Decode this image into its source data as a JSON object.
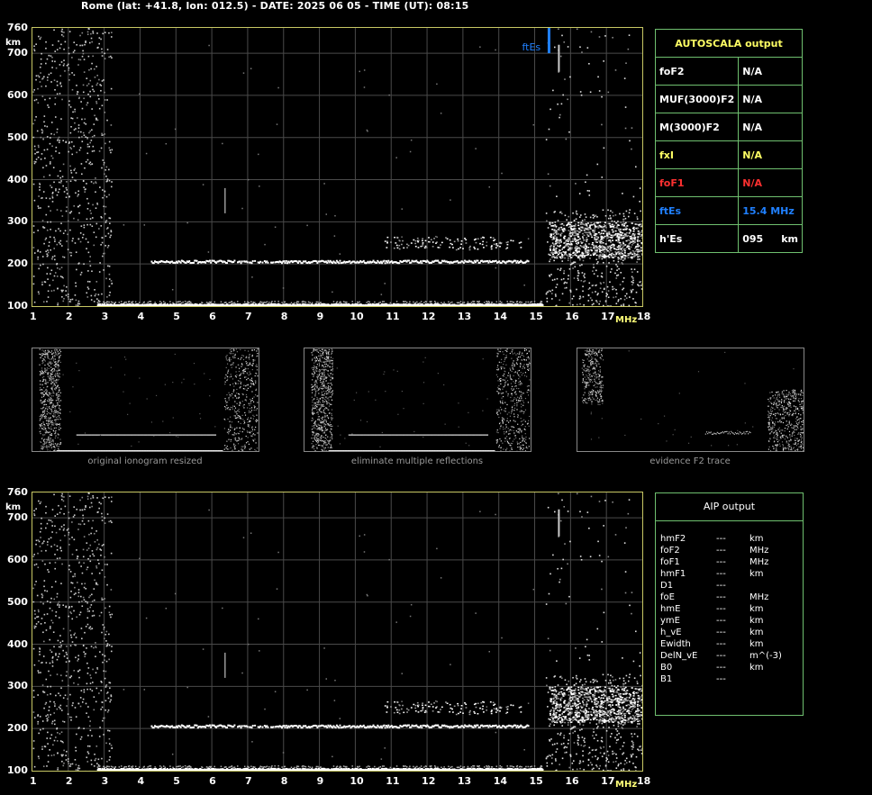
{
  "header": {
    "title": "Rome (lat: +41.8, lon: 012.5) - DATE: 2025 06 05 - TIME (UT): 08:15"
  },
  "axes": {
    "y_ticks": [
      "760",
      "700",
      "600",
      "500",
      "400",
      "300",
      "200",
      "100"
    ],
    "y_unit": "km",
    "x_ticks": [
      "1",
      "2",
      "3",
      "4",
      "5",
      "6",
      "7",
      "8",
      "9",
      "10",
      "11",
      "12",
      "13",
      "14",
      "15",
      "16",
      "17",
      "18"
    ],
    "x_unit": "MHz"
  },
  "ftes_marker": {
    "label": "ftEs",
    "freq_mhz": 15.4,
    "color": "#2080ff"
  },
  "autoscala": {
    "title": "AUTOSCALA output",
    "rows": [
      {
        "name": "foF2",
        "value": "N/A",
        "color": "#ffffff"
      },
      {
        "name": "MUF(3000)F2",
        "value": "N/A",
        "color": "#ffffff"
      },
      {
        "name": "M(3000)F2",
        "value": "N/A",
        "color": "#ffffff"
      },
      {
        "name": "fxI",
        "value": "N/A",
        "color": "#ffff64"
      },
      {
        "name": "foF1",
        "value": "N/A",
        "color": "#ff3030"
      },
      {
        "name": "ftEs",
        "value": "15.4 MHz",
        "color": "#2080ff"
      },
      {
        "name": "h'Es",
        "value": "095",
        "unit": "km",
        "color": "#ffffff"
      }
    ]
  },
  "thumbnails": [
    {
      "caption": "original ionogram resized"
    },
    {
      "caption": "eliminate multiple reflections"
    },
    {
      "caption": "evidence F2 trace"
    }
  ],
  "aip": {
    "title": "AIP output",
    "rows": [
      {
        "name": "hmF2",
        "value": "---",
        "unit": "km"
      },
      {
        "name": "foF2",
        "value": "---",
        "unit": "MHz"
      },
      {
        "name": "foF1",
        "value": "---",
        "unit": "MHz"
      },
      {
        "name": "hmF1",
        "value": "---",
        "unit": "km"
      },
      {
        "name": "D1",
        "value": "---",
        "unit": ""
      },
      {
        "name": "foE",
        "value": "---",
        "unit": "MHz"
      },
      {
        "name": "hmE",
        "value": "---",
        "unit": "km"
      },
      {
        "name": "ymE",
        "value": "---",
        "unit": "km"
      },
      {
        "name": "h_vE",
        "value": "---",
        "unit": "km"
      },
      {
        "name": "Ewidth",
        "value": "---",
        "unit": "km"
      },
      {
        "name": "DelN_vE",
        "value": "---",
        "unit": "m^(-3)"
      },
      {
        "name": "B0",
        "value": "---",
        "unit": "km"
      },
      {
        "name": "B1",
        "value": "---",
        "unit": ""
      }
    ]
  }
}
